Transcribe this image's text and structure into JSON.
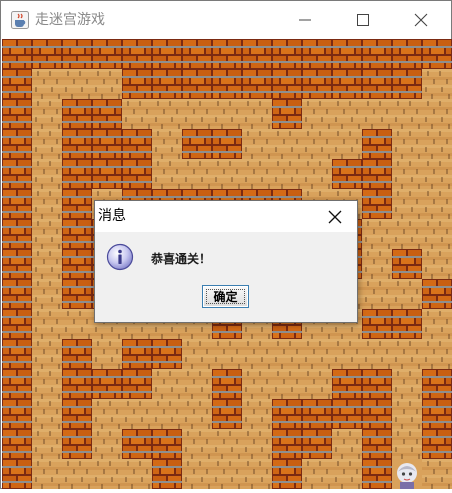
{
  "window": {
    "title": "走迷宫游戏",
    "icon": "java-cup-icon",
    "controls": [
      "minimize-icon",
      "maximize-icon",
      "close-icon"
    ]
  },
  "maze": {
    "grid_size": 15,
    "wall_color": "#c86414",
    "floor_color": "#d9a25c",
    "layout": [
      "###############",
      "#...##########.#",
      "#.##.....#.....#",
      "#.###.##....#..#",
      "#.###......##..#",
      "#.#.######..#..#",
      "#.###.#.####...#",
      "#.#######.##.#.#",
      "#.##.##.......#.#",
      "#......#.#..##.#",
      "#.#.##.........#",
      "#.###..#...##.#.",
      "#.#....#.####.#.",
      "#.#.##...##.#.#.",
      "#....#...#..#..."
    ],
    "player_icon": "player-character-icon"
  },
  "dialog": {
    "title": "消息",
    "message": "恭喜通关！",
    "icon": "info-icon",
    "ok_button": "确定",
    "close_icon": "close-icon"
  }
}
